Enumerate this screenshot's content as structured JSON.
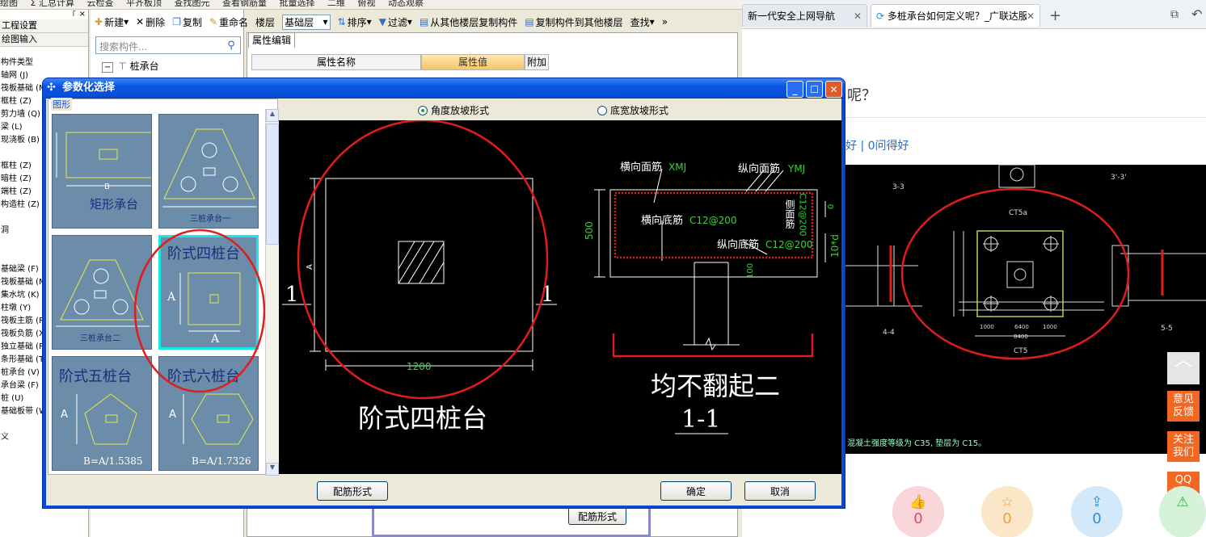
{
  "app": {
    "topbar_items": [
      "绘图",
      "Σ 汇总计算",
      "云检查",
      "平齐板顶",
      "查找图元",
      "查看钢筋量",
      "批量选择",
      "二维",
      "俯视",
      "动态观察"
    ],
    "panel_pin": "꜒ ×",
    "left_headers": [
      "工程设置",
      "绘图输入"
    ],
    "left_items": [
      "构件类型",
      "轴网 (J)",
      "筏板基础 (M",
      "框柱 (Z)",
      "剪力墙 (Q)",
      "梁 (L)",
      "现浇板 (B)",
      "",
      "框柱 (Z)",
      "暗柱 (Z)",
      "端柱 (Z)",
      "构造柱 (Z)",
      "",
      "洞",
      "",
      "",
      "基础梁 (F)",
      "筏板基础 (M",
      "集水坑 (K)",
      "柱墩 (Y)",
      "筏板主筋 (R",
      "筏板负筋 (X",
      "独立基础 (P",
      "条形基础 (T",
      "桩承台 (V)",
      "承台梁 (F)",
      "桩 (U)",
      "基础板带 (W",
      "",
      "义"
    ],
    "toolbar": [
      "新建",
      "删除",
      "复制",
      "重命名",
      "楼层",
      "基础层",
      "排序",
      "过滤",
      "从其他楼层复制构件",
      "复制构件到其他楼层",
      "查找"
    ],
    "more": "»",
    "search_placeholder": "搜索构件...",
    "tree_root": "桩承台",
    "prop_tab": "属性编辑",
    "prop_headers": [
      "属性名称",
      "属性值",
      "附加"
    ],
    "bg_button": "配筋形式"
  },
  "browser": {
    "tabs": [
      "新一代安全上网导航",
      "多桩承台如何定义呢？_广联达服"
    ],
    "page_title": "呢？",
    "stats": "好 | 0问得好",
    "side_buttons": [
      "意见\n反馈",
      "关注\n我们",
      "QQ\n咨询"
    ],
    "reactions": [
      {
        "icon": "👍",
        "count": "0",
        "color": "#f8d6d9",
        "fg": "#e04c5d"
      },
      {
        "icon": "☆",
        "count": "0",
        "color": "#fbe6c8",
        "fg": "#e8a23c"
      },
      {
        "icon": "⇪",
        "count": "0",
        "color": "#d3e8f9",
        "fg": "#2e8fd8"
      },
      {
        "icon": "⚠",
        "count": "",
        "color": "#d6f2d8",
        "fg": "#3ab04c"
      }
    ],
    "cad_labels": {
      "s33": "3-3",
      "s3p": "3'-3'",
      "ct5a": "CT5a",
      "ct5": "CT5",
      "s44": "4-4",
      "s55": "5-5",
      "note": "混凝土强度等级为 C35, 垫层为 C15。",
      "d1": "1000",
      "d2": "6400",
      "d3": "8400"
    }
  },
  "dialog": {
    "title": "参数化选择",
    "group_label": "图形",
    "radio_angle": "角度放坡形式",
    "radio_width": "底宽放坡形式",
    "thumbs": [
      {
        "name": "矩形承台",
        "sub": "B",
        "dim": ""
      },
      {
        "name": "三桩承台一",
        "sub": "",
        "dim": ""
      },
      {
        "name": "三桩承台二",
        "sub": "",
        "dim": ""
      },
      {
        "name": "阶式四桩台",
        "sub": "A",
        "dim": "A"
      },
      {
        "name": "阶式五桩台",
        "sub": "B=A/1.5385",
        "dim": "A"
      },
      {
        "name": "阶式六桩台",
        "sub": "B=A/1.7326",
        "dim": "A"
      }
    ],
    "preview": {
      "width_dim": "1200",
      "side_a": "A",
      "mark": "1",
      "caption": "阶式四桩台",
      "top_bar": "横向面筋",
      "top_bar_code": "XMJ",
      "long_top": "纵向面筋",
      "long_top_code": "YMJ",
      "bottom_bar": "横向底筋",
      "bottom_bar_code": "C12@200",
      "long_bottom": "纵向底筋",
      "long_bottom_code": "C12@200",
      "side_bar": "侧面筋",
      "side_bar_code": "C12@200",
      "height": "500",
      "cover": "0",
      "anchor": "10*d",
      "d100": "100",
      "note": "均不翻起二",
      "section": "1-1"
    },
    "cfg_button": "配筋形式",
    "ok": "确定",
    "cancel": "取消"
  }
}
